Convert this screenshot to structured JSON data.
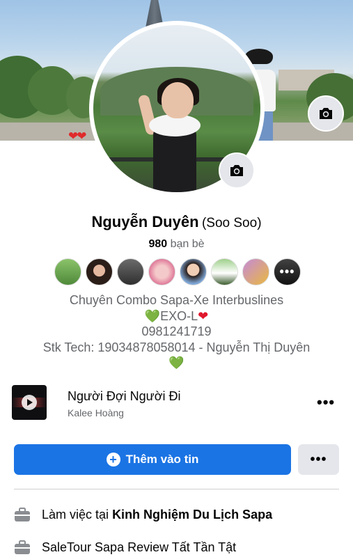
{
  "profile": {
    "name": "Nguyễn Duyên",
    "alternate_name": "(Soo Soo)",
    "friends_count": "980",
    "friends_label": "bạn bè"
  },
  "cover": {
    "icon": "camera-icon",
    "hearts": "❤❤"
  },
  "bio": {
    "line1": "Chuyên Combo Sapa-Xe Interbuslines",
    "line2_heart_left": "💚",
    "line2_text": "EXO-L",
    "line2_heart_right": "❤",
    "line3": "0981241719",
    "line4": "Stk Tech: 19034878058014 - Nguyễn Thị Duyên",
    "line5": "💚"
  },
  "friend_avatars": {
    "count_shown": 8,
    "more_label": "•••"
  },
  "music": {
    "title": "Người Đợi Người Đi",
    "artist": "Kalee Hoàng",
    "more_label": "•••"
  },
  "actions": {
    "add_story_label": "Thêm vào tin",
    "more_label": "•••"
  },
  "info": {
    "work_prefix": "Làm việc tại",
    "work_place": "Kinh Nghiệm Du Lịch Sapa",
    "second_line": "SaleTour Sapa Review Tất Tần Tật"
  },
  "colors": {
    "primary": "#1b74e4",
    "secondary_button": "#e4e6eb",
    "muted_text": "#65676b"
  }
}
